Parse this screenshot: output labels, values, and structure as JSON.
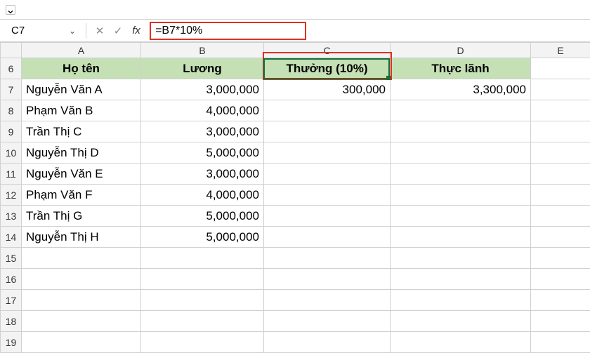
{
  "quick_access": {
    "dropdown_glyph": "⌄"
  },
  "formula_bar": {
    "cell_ref": "C7",
    "dropdown_glyph": "⌄",
    "cancel_glyph": "✕",
    "accept_glyph": "✓",
    "fx_label": "fx",
    "formula": "=B7*10%"
  },
  "columns": [
    "A",
    "B",
    "C",
    "D",
    "E"
  ],
  "first_row_number": 6,
  "headers": {
    "a": "Họ tên",
    "b": "Lương",
    "c": "Thưởng (10%)",
    "d": "Thực lãnh"
  },
  "rows": [
    {
      "n": 7,
      "name": "Nguyễn Văn A",
      "salary": "3,000,000",
      "bonus": "300,000",
      "total": "3,300,000"
    },
    {
      "n": 8,
      "name": "Phạm Văn B",
      "salary": "4,000,000",
      "bonus": "",
      "total": ""
    },
    {
      "n": 9,
      "name": "Trần Thị C",
      "salary": "3,000,000",
      "bonus": "",
      "total": ""
    },
    {
      "n": 10,
      "name": "Nguyễn Thị D",
      "salary": "5,000,000",
      "bonus": "",
      "total": ""
    },
    {
      "n": 11,
      "name": "Nguyễn Văn E",
      "salary": "3,000,000",
      "bonus": "",
      "total": ""
    },
    {
      "n": 12,
      "name": "Phạm Văn F",
      "salary": "4,000,000",
      "bonus": "",
      "total": ""
    },
    {
      "n": 13,
      "name": "Trần Thị G",
      "salary": "5,000,000",
      "bonus": "",
      "total": ""
    },
    {
      "n": 14,
      "name": "Nguyễn Thị H",
      "salary": "5,000,000",
      "bonus": "",
      "total": ""
    }
  ],
  "empty_row_count": 5,
  "colors": {
    "header_fill": "#c5e0b4",
    "highlight": "#e03020",
    "selection": "#0f703b"
  }
}
